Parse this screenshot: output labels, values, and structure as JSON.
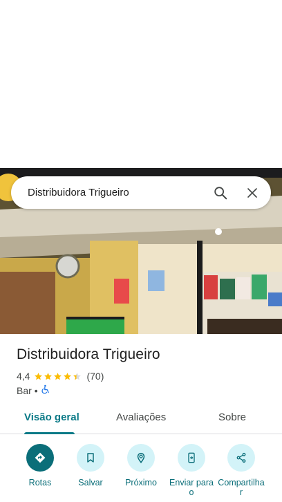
{
  "search": {
    "query": "Distribuidora Trigueiro"
  },
  "place": {
    "name": "Distribuidora Trigueiro",
    "rating": "4,4",
    "rating_value": 4.4,
    "review_count": "(70)",
    "category": "Bar",
    "separator": "•"
  },
  "tabs": [
    {
      "label": "Visão geral",
      "active": true
    },
    {
      "label": "Avaliações",
      "active": false
    },
    {
      "label": "Sobre",
      "active": false
    }
  ],
  "actions": [
    {
      "label": "Rotas",
      "icon": "directions-icon"
    },
    {
      "label": "Salvar",
      "icon": "bookmark-icon"
    },
    {
      "label": "Próximo",
      "icon": "nearby-icon"
    },
    {
      "label": "Enviar para o",
      "icon": "send-to-phone-icon"
    },
    {
      "label": "Compartilhar",
      "icon": "share-icon"
    }
  ],
  "colors": {
    "accent": "#0b6e79",
    "star": "#fbbc04",
    "chip_bg": "#d3f3f8"
  }
}
